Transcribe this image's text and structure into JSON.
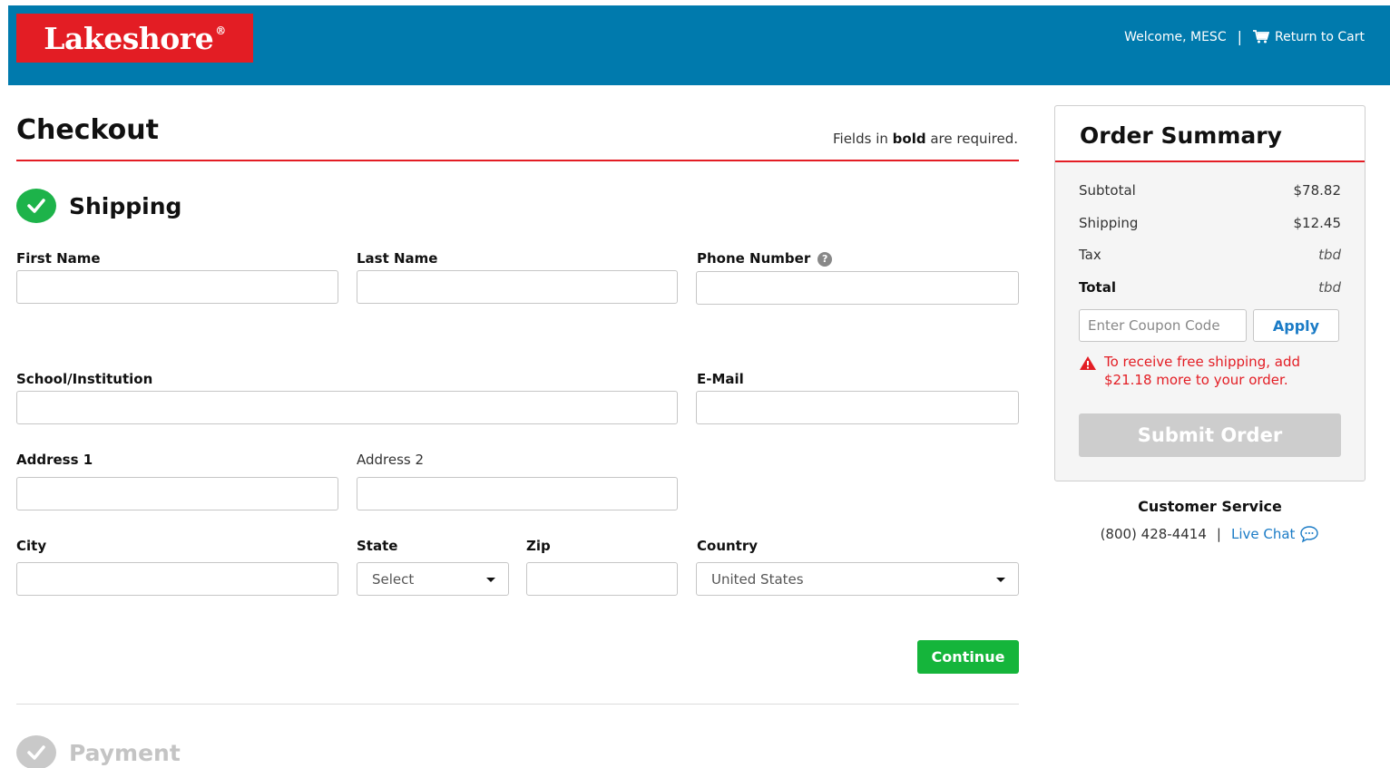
{
  "header": {
    "logo_text": "Lakeshore",
    "logo_mark": "®",
    "welcome": "Welcome, MESC",
    "separator": "|",
    "return_to_cart": "Return to Cart",
    "cart_icon": "cart-icon",
    "color": "#007aad",
    "logo_color": "#e31d24"
  },
  "checkout": {
    "title": "Checkout",
    "required_note_pre": "Fields in ",
    "required_note_bold": "bold",
    "required_note_post": " are required."
  },
  "shipping": {
    "section_title": "Shipping",
    "status_icon": "check-circle-icon",
    "fields": {
      "first_name": {
        "label": "First Name",
        "value": ""
      },
      "last_name": {
        "label": "Last Name",
        "value": ""
      },
      "phone": {
        "label": "Phone Number",
        "value": "",
        "help_icon": "question-circle-icon"
      },
      "school": {
        "label": "School/Institution",
        "value": ""
      },
      "email": {
        "label": "E-Mail",
        "value": ""
      },
      "address1": {
        "label": "Address 1",
        "value": ""
      },
      "address2": {
        "label": "Address 2",
        "value": ""
      },
      "city": {
        "label": "City",
        "value": ""
      },
      "state": {
        "label": "State",
        "selected": "Select"
      },
      "zip": {
        "label": "Zip",
        "value": ""
      },
      "country": {
        "label": "Country",
        "selected": "United States"
      }
    },
    "continue_label": "Continue"
  },
  "payment": {
    "section_title": "Payment",
    "status_icon": "check-circle-icon"
  },
  "summary": {
    "title": "Order Summary",
    "rows": [
      {
        "label": "Subtotal",
        "value": "$78.82"
      },
      {
        "label": "Shipping",
        "value": "$12.45"
      },
      {
        "label": "Tax",
        "value": "tbd"
      },
      {
        "label": "Total",
        "value": "tbd"
      }
    ],
    "coupon_placeholder": "Enter Coupon Code",
    "apply_label": "Apply",
    "free_shipping_message": "To receive free shipping, add $21.18 more to your order.",
    "warning_icon": "warning-icon",
    "submit_label": "Submit Order"
  },
  "customer_service": {
    "title": "Customer Service",
    "phone": "(800) 428-4414",
    "separator": "|",
    "live_chat": "Live Chat",
    "chat_icon": "chat-bubble-icon"
  }
}
